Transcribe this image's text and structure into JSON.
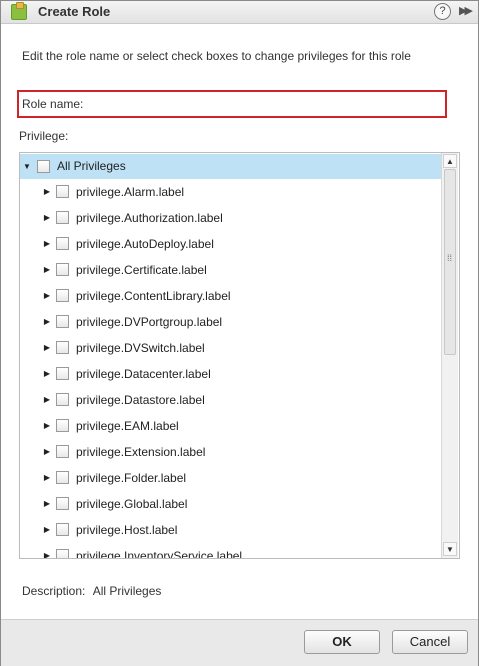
{
  "dialog": {
    "title": "Create Role",
    "help_glyph": "?",
    "expand_glyph": "▶▶"
  },
  "instructions": "Edit the role name or select check boxes to change privileges for this role",
  "role_name": {
    "label": "Role name:",
    "value": "",
    "border_color": "#d1232a"
  },
  "privilege_label": "Privilege:",
  "tree": {
    "root": {
      "label": "All Privileges",
      "expanded": true,
      "selected": true
    },
    "items": [
      {
        "label": "privilege.Alarm.label"
      },
      {
        "label": "privilege.Authorization.label"
      },
      {
        "label": "privilege.AutoDeploy.label"
      },
      {
        "label": "privilege.Certificate.label"
      },
      {
        "label": "privilege.ContentLibrary.label"
      },
      {
        "label": "privilege.DVPortgroup.label"
      },
      {
        "label": "privilege.DVSwitch.label"
      },
      {
        "label": "privilege.Datacenter.label"
      },
      {
        "label": "privilege.Datastore.label"
      },
      {
        "label": "privilege.EAM.label"
      },
      {
        "label": "privilege.Extension.label"
      },
      {
        "label": "privilege.Folder.label"
      },
      {
        "label": "privilege.Global.label"
      },
      {
        "label": "privilege.Host.label"
      },
      {
        "label": "privilege.InventoryService.label"
      }
    ],
    "selection_color": "#bfe1f6"
  },
  "description": {
    "label": "Description:",
    "value": "All Privileges"
  },
  "buttons": {
    "ok": "OK",
    "cancel": "Cancel"
  }
}
